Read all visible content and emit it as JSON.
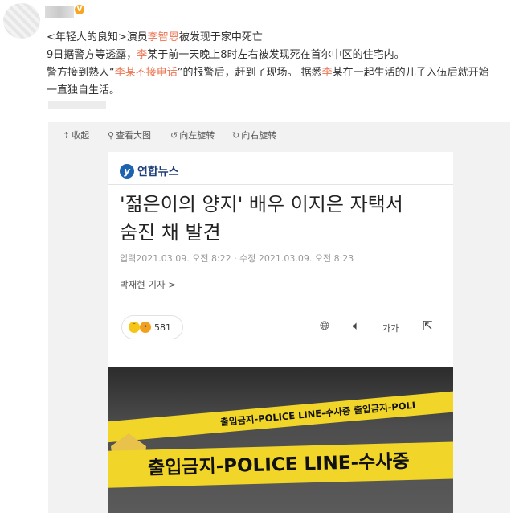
{
  "post": {
    "line1_parts": [
      "<年轻人的良知>演员",
      "李智恩",
      "被发现于家中死亡"
    ],
    "line2_parts": [
      "9日据警方等透露，",
      "李",
      "某于前一天晚上8时左右被发现死在首尔中区的住宅内。"
    ],
    "line3_parts": [
      "警方接到熟人“",
      "李某不接电话",
      "”的报警后，赶到了现场。 据悉",
      "李",
      "某在一起生活的儿子入伍后就开始"
    ],
    "line4": "一直独自生活。"
  },
  "toolbar": {
    "collapse": "收起",
    "view_large": "查看大图",
    "rotate_left": "向左旋转",
    "rotate_right": "向右旋转"
  },
  "article": {
    "source": "연합뉴스",
    "headline_line1": "'젊은이의 양지' 배우 이지은 자택서",
    "headline_line2": "숨진 채 발견",
    "meta": "입력2021.03.09. 오전 8:22 · 수정 2021.03.09. 오전 8:23",
    "reporter": "박재현 기자 >",
    "reaction_count": "581",
    "font_size_label": "가가",
    "tape_small_text": "출입금지-POLICE LINE-수사중  출입금지-POLI",
    "tape_large_text": "출입금지-POLICE LINE-수사중"
  },
  "icons": {
    "collapse": "upload-icon",
    "view": "magnifier-icon",
    "rotate_left": "rotate-left-icon",
    "rotate_right": "rotate-right-icon",
    "globe": "globe-icon",
    "speaker": "speaker-icon",
    "share": "share-icon"
  },
  "colors": {
    "highlight": "#eb7350",
    "tape": "#f1d629",
    "brand": "#1e63b0"
  }
}
